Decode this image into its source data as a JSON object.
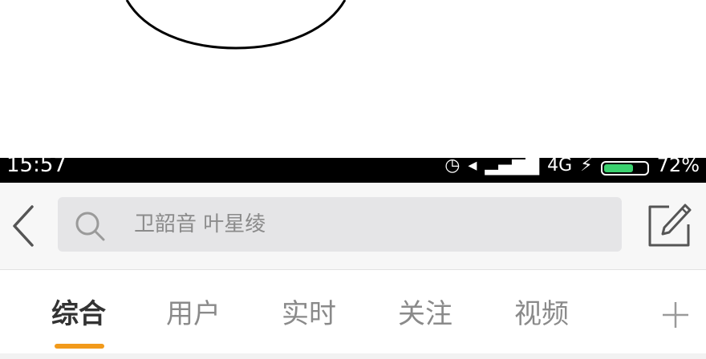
{
  "status_bar": {
    "time": "15:57",
    "network_label": "4G",
    "battery_text": "72%",
    "battery_level": 0.72
  },
  "search": {
    "placeholder": "卫韶音 叶星绫"
  },
  "tabs": [
    {
      "label": "综合",
      "active": true
    },
    {
      "label": "用户",
      "active": false
    },
    {
      "label": "实时",
      "active": false
    },
    {
      "label": "关注",
      "active": false
    },
    {
      "label": "视频",
      "active": false
    }
  ],
  "colors": {
    "accent": "#f29a1b",
    "battery": "#3bd16f"
  },
  "icons": {
    "back": "chevron-left-icon",
    "search": "search-icon",
    "compose": "compose-icon",
    "add": "plus-icon"
  }
}
